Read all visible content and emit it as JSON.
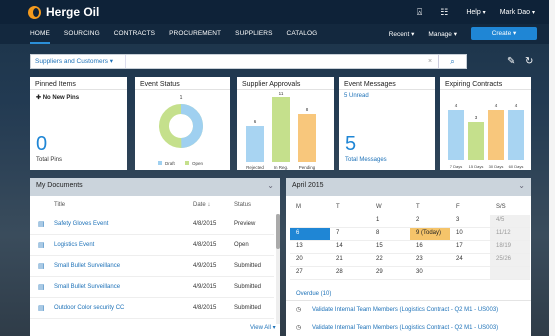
{
  "app": {
    "name": "Herge Oil"
  },
  "topbar": {
    "help": "Help",
    "user": "Mark Dao"
  },
  "nav": {
    "items": [
      "HOME",
      "SOURCING",
      "CONTRACTS",
      "PROCUREMENT",
      "SUPPLIERS",
      "CATALOG"
    ],
    "recent": "Recent",
    "manage": "Manage",
    "create": "Create"
  },
  "search": {
    "scope": "Suppliers and Customers"
  },
  "cards": {
    "pinned": {
      "title": "Pinned Items",
      "sub": "No New Pins",
      "count": "0",
      "label": "Total Pins"
    },
    "status": {
      "title": "Event Status",
      "count": "1",
      "legend": [
        "Draft",
        "Open"
      ]
    },
    "approvals": {
      "title": "Supplier Approvals",
      "values": [
        "6",
        "11",
        "8"
      ],
      "labels": [
        "Rejected",
        "In Reg.",
        "Pending"
      ]
    },
    "messages": {
      "title": "Event Messages",
      "unread": "5 Unread",
      "count": "5",
      "label": "Total Messages"
    },
    "contracts": {
      "title": "Expiring Contracts",
      "values": [
        "4",
        "3",
        "4",
        "4"
      ],
      "labels": [
        "7 Days",
        "15 Days",
        "30 Days",
        "60 Days"
      ]
    }
  },
  "chart_data": [
    {
      "type": "pie",
      "title": "Event Status",
      "categories": [
        "Draft",
        "Open"
      ],
      "values": [
        0,
        1
      ],
      "donut": true
    },
    {
      "type": "bar",
      "title": "Supplier Approvals",
      "categories": [
        "Rejected",
        "In Reg.",
        "Pending"
      ],
      "values": [
        6,
        11,
        8
      ],
      "ylim": [
        0,
        12
      ],
      "colors": [
        "#a8d4f2",
        "#c5e08c",
        "#f8c77c"
      ]
    },
    {
      "type": "bar",
      "title": "Expiring Contracts",
      "categories": [
        "7 Days",
        "15 Days",
        "30 Days",
        "60 Days"
      ],
      "values": [
        4,
        3,
        4,
        4
      ],
      "ylim": [
        0,
        5
      ],
      "colors": [
        "#a8d4f2",
        "#c5e08c",
        "#f8c77c",
        "#a8d4f2"
      ]
    }
  ],
  "docs": {
    "title": "My Documents",
    "cols": {
      "title": "Title",
      "date": "Date ↓",
      "status": "Status"
    },
    "rows": [
      {
        "title": "Safety Gloves Event",
        "date": "4/8/2015",
        "status": "Preview"
      },
      {
        "title": "Logistics Event",
        "date": "4/8/2015",
        "status": "Open"
      },
      {
        "title": "Small Bullet Surveillance",
        "date": "4/9/2015",
        "status": "Submitted"
      },
      {
        "title": "Small Bullet Surveillance",
        "date": "4/9/2015",
        "status": "Submitted"
      },
      {
        "title": "Outdoor Color security CC",
        "date": "4/8/2015",
        "status": "Submitted"
      }
    ],
    "view_all": "View All"
  },
  "calendar": {
    "title": "April 2015",
    "days": [
      "M",
      "T",
      "W",
      "T",
      "F",
      "S/S"
    ],
    "weeks": [
      [
        "",
        "",
        "1",
        "2",
        "3",
        "4/5"
      ],
      [
        "6",
        "7",
        "8",
        "9 (Today)",
        "10",
        "11/12"
      ],
      [
        "13",
        "14",
        "15",
        "16",
        "17",
        "18/19"
      ],
      [
        "20",
        "21",
        "22",
        "23",
        "24",
        "25/26"
      ],
      [
        "27",
        "28",
        "29",
        "30",
        "",
        ""
      ]
    ],
    "overdue": "Overdue (10)",
    "tasks": [
      "Validate Internal Team Members (Logistics Contract - Q2 M1 - US003)",
      "Validate Internal Team Members (Logistics Contract - Q2 M1 - US003)"
    ]
  }
}
